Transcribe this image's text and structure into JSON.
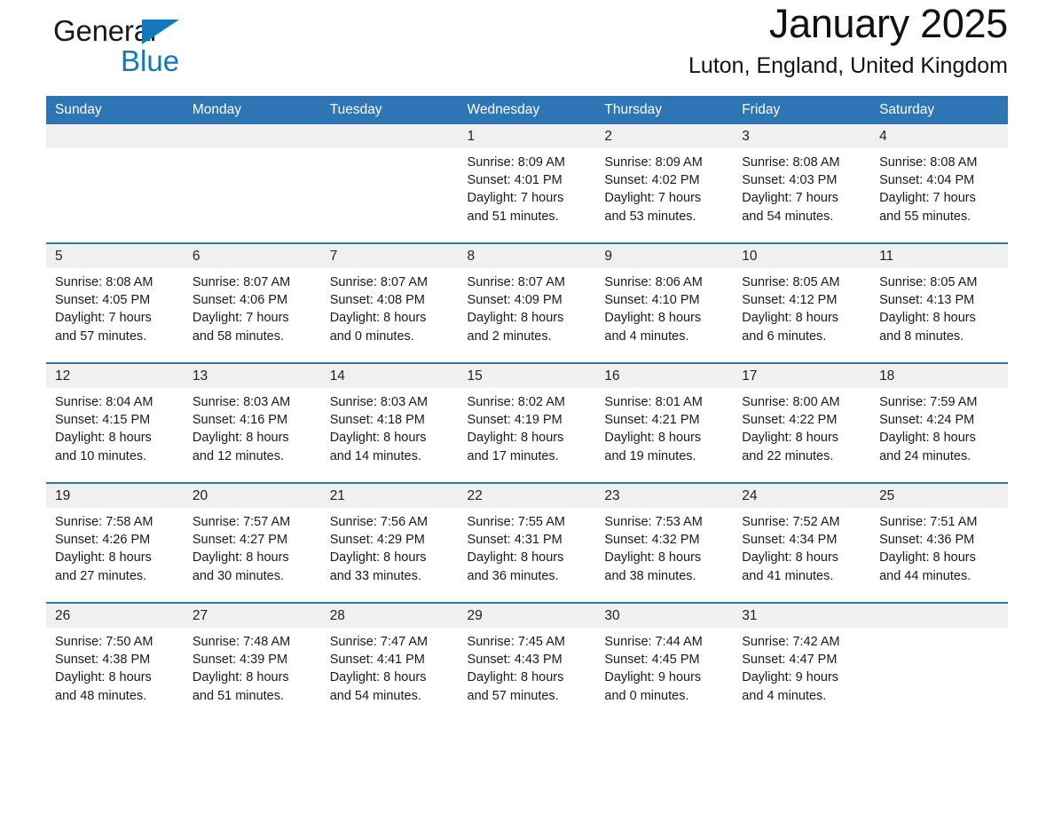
{
  "brand": {
    "name_part1": "General",
    "name_part2": "Blue"
  },
  "header": {
    "month_title": "January 2025",
    "location": "Luton, England, United Kingdom"
  },
  "theme": {
    "header_blue": "#2e75b6",
    "logo_blue": "#1277bd",
    "daynum_band": "#f0f0f0",
    "text": "#1a1a1a"
  },
  "weekday_headers": [
    "Sunday",
    "Monday",
    "Tuesday",
    "Wednesday",
    "Thursday",
    "Friday",
    "Saturday"
  ],
  "weeks": [
    [
      {
        "day": "",
        "sunrise": "",
        "sunset": "",
        "daylight_line1": "",
        "daylight_line2": ""
      },
      {
        "day": "",
        "sunrise": "",
        "sunset": "",
        "daylight_line1": "",
        "daylight_line2": ""
      },
      {
        "day": "",
        "sunrise": "",
        "sunset": "",
        "daylight_line1": "",
        "daylight_line2": ""
      },
      {
        "day": "1",
        "sunrise": "Sunrise: 8:09 AM",
        "sunset": "Sunset: 4:01 PM",
        "daylight_line1": "Daylight: 7 hours",
        "daylight_line2": "and 51 minutes."
      },
      {
        "day": "2",
        "sunrise": "Sunrise: 8:09 AM",
        "sunset": "Sunset: 4:02 PM",
        "daylight_line1": "Daylight: 7 hours",
        "daylight_line2": "and 53 minutes."
      },
      {
        "day": "3",
        "sunrise": "Sunrise: 8:08 AM",
        "sunset": "Sunset: 4:03 PM",
        "daylight_line1": "Daylight: 7 hours",
        "daylight_line2": "and 54 minutes."
      },
      {
        "day": "4",
        "sunrise": "Sunrise: 8:08 AM",
        "sunset": "Sunset: 4:04 PM",
        "daylight_line1": "Daylight: 7 hours",
        "daylight_line2": "and 55 minutes."
      }
    ],
    [
      {
        "day": "5",
        "sunrise": "Sunrise: 8:08 AM",
        "sunset": "Sunset: 4:05 PM",
        "daylight_line1": "Daylight: 7 hours",
        "daylight_line2": "and 57 minutes."
      },
      {
        "day": "6",
        "sunrise": "Sunrise: 8:07 AM",
        "sunset": "Sunset: 4:06 PM",
        "daylight_line1": "Daylight: 7 hours",
        "daylight_line2": "and 58 minutes."
      },
      {
        "day": "7",
        "sunrise": "Sunrise: 8:07 AM",
        "sunset": "Sunset: 4:08 PM",
        "daylight_line1": "Daylight: 8 hours",
        "daylight_line2": "and 0 minutes."
      },
      {
        "day": "8",
        "sunrise": "Sunrise: 8:07 AM",
        "sunset": "Sunset: 4:09 PM",
        "daylight_line1": "Daylight: 8 hours",
        "daylight_line2": "and 2 minutes."
      },
      {
        "day": "9",
        "sunrise": "Sunrise: 8:06 AM",
        "sunset": "Sunset: 4:10 PM",
        "daylight_line1": "Daylight: 8 hours",
        "daylight_line2": "and 4 minutes."
      },
      {
        "day": "10",
        "sunrise": "Sunrise: 8:05 AM",
        "sunset": "Sunset: 4:12 PM",
        "daylight_line1": "Daylight: 8 hours",
        "daylight_line2": "and 6 minutes."
      },
      {
        "day": "11",
        "sunrise": "Sunrise: 8:05 AM",
        "sunset": "Sunset: 4:13 PM",
        "daylight_line1": "Daylight: 8 hours",
        "daylight_line2": "and 8 minutes."
      }
    ],
    [
      {
        "day": "12",
        "sunrise": "Sunrise: 8:04 AM",
        "sunset": "Sunset: 4:15 PM",
        "daylight_line1": "Daylight: 8 hours",
        "daylight_line2": "and 10 minutes."
      },
      {
        "day": "13",
        "sunrise": "Sunrise: 8:03 AM",
        "sunset": "Sunset: 4:16 PM",
        "daylight_line1": "Daylight: 8 hours",
        "daylight_line2": "and 12 minutes."
      },
      {
        "day": "14",
        "sunrise": "Sunrise: 8:03 AM",
        "sunset": "Sunset: 4:18 PM",
        "daylight_line1": "Daylight: 8 hours",
        "daylight_line2": "and 14 minutes."
      },
      {
        "day": "15",
        "sunrise": "Sunrise: 8:02 AM",
        "sunset": "Sunset: 4:19 PM",
        "daylight_line1": "Daylight: 8 hours",
        "daylight_line2": "and 17 minutes."
      },
      {
        "day": "16",
        "sunrise": "Sunrise: 8:01 AM",
        "sunset": "Sunset: 4:21 PM",
        "daylight_line1": "Daylight: 8 hours",
        "daylight_line2": "and 19 minutes."
      },
      {
        "day": "17",
        "sunrise": "Sunrise: 8:00 AM",
        "sunset": "Sunset: 4:22 PM",
        "daylight_line1": "Daylight: 8 hours",
        "daylight_line2": "and 22 minutes."
      },
      {
        "day": "18",
        "sunrise": "Sunrise: 7:59 AM",
        "sunset": "Sunset: 4:24 PM",
        "daylight_line1": "Daylight: 8 hours",
        "daylight_line2": "and 24 minutes."
      }
    ],
    [
      {
        "day": "19",
        "sunrise": "Sunrise: 7:58 AM",
        "sunset": "Sunset: 4:26 PM",
        "daylight_line1": "Daylight: 8 hours",
        "daylight_line2": "and 27 minutes."
      },
      {
        "day": "20",
        "sunrise": "Sunrise: 7:57 AM",
        "sunset": "Sunset: 4:27 PM",
        "daylight_line1": "Daylight: 8 hours",
        "daylight_line2": "and 30 minutes."
      },
      {
        "day": "21",
        "sunrise": "Sunrise: 7:56 AM",
        "sunset": "Sunset: 4:29 PM",
        "daylight_line1": "Daylight: 8 hours",
        "daylight_line2": "and 33 minutes."
      },
      {
        "day": "22",
        "sunrise": "Sunrise: 7:55 AM",
        "sunset": "Sunset: 4:31 PM",
        "daylight_line1": "Daylight: 8 hours",
        "daylight_line2": "and 36 minutes."
      },
      {
        "day": "23",
        "sunrise": "Sunrise: 7:53 AM",
        "sunset": "Sunset: 4:32 PM",
        "daylight_line1": "Daylight: 8 hours",
        "daylight_line2": "and 38 minutes."
      },
      {
        "day": "24",
        "sunrise": "Sunrise: 7:52 AM",
        "sunset": "Sunset: 4:34 PM",
        "daylight_line1": "Daylight: 8 hours",
        "daylight_line2": "and 41 minutes."
      },
      {
        "day": "25",
        "sunrise": "Sunrise: 7:51 AM",
        "sunset": "Sunset: 4:36 PM",
        "daylight_line1": "Daylight: 8 hours",
        "daylight_line2": "and 44 minutes."
      }
    ],
    [
      {
        "day": "26",
        "sunrise": "Sunrise: 7:50 AM",
        "sunset": "Sunset: 4:38 PM",
        "daylight_line1": "Daylight: 8 hours",
        "daylight_line2": "and 48 minutes."
      },
      {
        "day": "27",
        "sunrise": "Sunrise: 7:48 AM",
        "sunset": "Sunset: 4:39 PM",
        "daylight_line1": "Daylight: 8 hours",
        "daylight_line2": "and 51 minutes."
      },
      {
        "day": "28",
        "sunrise": "Sunrise: 7:47 AM",
        "sunset": "Sunset: 4:41 PM",
        "daylight_line1": "Daylight: 8 hours",
        "daylight_line2": "and 54 minutes."
      },
      {
        "day": "29",
        "sunrise": "Sunrise: 7:45 AM",
        "sunset": "Sunset: 4:43 PM",
        "daylight_line1": "Daylight: 8 hours",
        "daylight_line2": "and 57 minutes."
      },
      {
        "day": "30",
        "sunrise": "Sunrise: 7:44 AM",
        "sunset": "Sunset: 4:45 PM",
        "daylight_line1": "Daylight: 9 hours",
        "daylight_line2": "and 0 minutes."
      },
      {
        "day": "31",
        "sunrise": "Sunrise: 7:42 AM",
        "sunset": "Sunset: 4:47 PM",
        "daylight_line1": "Daylight: 9 hours",
        "daylight_line2": "and 4 minutes."
      },
      {
        "day": "",
        "sunrise": "",
        "sunset": "",
        "daylight_line1": "",
        "daylight_line2": ""
      }
    ]
  ]
}
